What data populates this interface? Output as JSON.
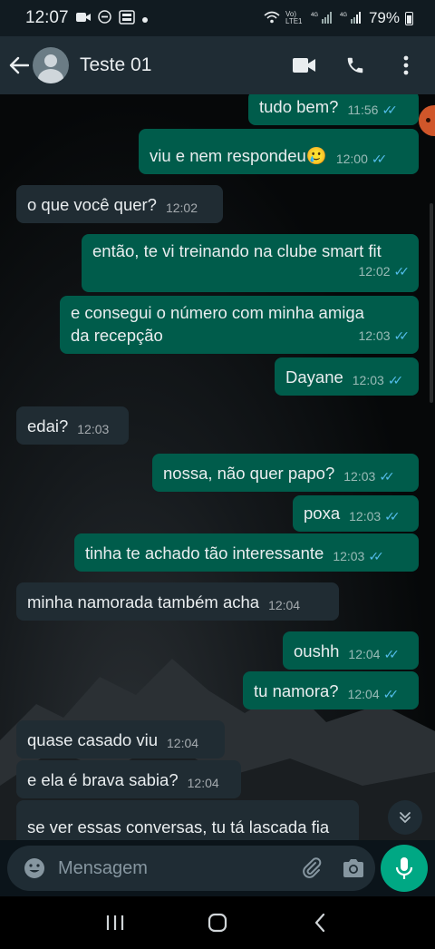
{
  "status_bar": {
    "time": "12:07",
    "left_icons": [
      "video-icon",
      "dnd-icon",
      "gallery-icon",
      "dot"
    ],
    "network": "Vo) LTE1",
    "battery": "79%"
  },
  "header": {
    "contact_name": "Teste 01",
    "actions": [
      "video-call-icon",
      "phone-icon",
      "more-icon"
    ]
  },
  "messages": [
    {
      "dir": "out",
      "text": "tudo bem?",
      "time": "11:56",
      "read": true
    },
    {
      "dir": "out",
      "text": "viu e nem respondeu🥲",
      "time": "12:00",
      "read": true
    },
    {
      "dir": "in",
      "text": "o que você quer?",
      "time": "12:02"
    },
    {
      "dir": "out",
      "text": "então, te vi treinando na clube smart fit",
      "time": "12:02",
      "read": true
    },
    {
      "dir": "out",
      "text": "e consegui o número com minha amiga\nda recepção",
      "time": "12:03",
      "read": true
    },
    {
      "dir": "out",
      "text": "Dayane",
      "time": "12:03",
      "read": true
    },
    {
      "dir": "in",
      "text": "edai?",
      "time": "12:03"
    },
    {
      "dir": "out",
      "text": "nossa, não quer papo?",
      "time": "12:03",
      "read": true
    },
    {
      "dir": "out",
      "text": "poxa",
      "time": "12:03",
      "read": true
    },
    {
      "dir": "out",
      "text": "tinha te achado tão interessante",
      "time": "12:03",
      "read": true
    },
    {
      "dir": "in",
      "text": "minha namorada também acha",
      "time": "12:04"
    },
    {
      "dir": "out",
      "text": "oushh",
      "time": "12:04",
      "read": true
    },
    {
      "dir": "out",
      "text": "tu namora?",
      "time": "12:04",
      "read": true
    },
    {
      "dir": "in",
      "text": "quase casado viu",
      "time": "12:04"
    },
    {
      "dir": "in",
      "text": "e ela é brava sabia?",
      "time": "12:04"
    },
    {
      "dir": "in",
      "text": "se ver essas conversas, tu tá lascada fia",
      "time": ""
    }
  ],
  "input": {
    "placeholder": "Mensagem"
  },
  "colors": {
    "outgoing_bubble": "#005c4b",
    "incoming_bubble": "#202c33",
    "header": "#1f2c34",
    "accent": "#00a884",
    "read_ticks": "#53bdeb"
  }
}
